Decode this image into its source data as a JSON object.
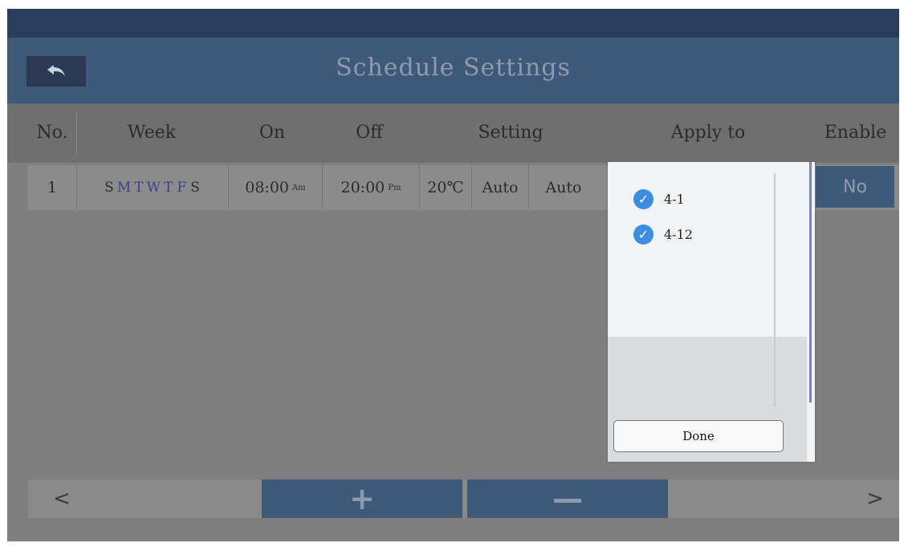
{
  "header": {
    "title": "Schedule Settings",
    "back_icon": "undo-arrow-icon"
  },
  "columns": {
    "no": "No.",
    "week": "Week",
    "on": "On",
    "off": "Off",
    "setting": "Setting",
    "apply_to": "Apply to",
    "enable": "Enable"
  },
  "rows": [
    {
      "no": "1",
      "days": [
        "S",
        "M",
        "T",
        "W",
        "T",
        "F",
        "S"
      ],
      "on_time": "08:00",
      "on_suffix": "Am",
      "off_time": "20:00",
      "off_suffix": "Pm",
      "temperature": "20℃",
      "mode": "Auto",
      "fan": "Auto",
      "enable": "No"
    }
  ],
  "popup": {
    "items": [
      {
        "label": "4-1",
        "checked": true
      },
      {
        "label": "4-12",
        "checked": true
      }
    ],
    "done_label": "Done",
    "check_glyph": "✓"
  },
  "footer_nav": {
    "prev": "<",
    "add": "+",
    "remove": "—",
    "next": ">"
  },
  "colors": {
    "title_bar": "#3f5a78",
    "top_strip": "#2b3d5c",
    "accent_check": "#3d8ce0",
    "day_selected": "#3a3f8a"
  }
}
